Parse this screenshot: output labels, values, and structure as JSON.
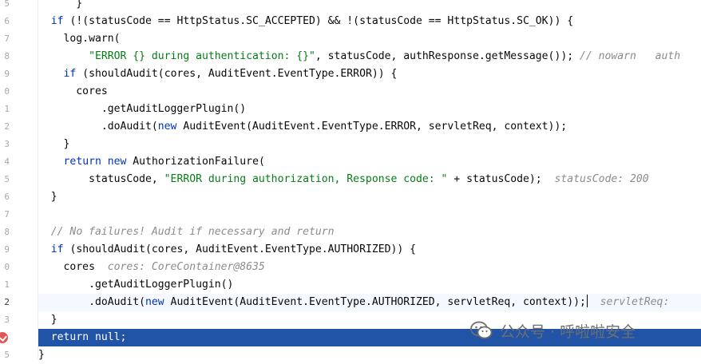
{
  "editor": {
    "gutter": [
      {
        "num": "5"
      },
      {
        "num": "6"
      },
      {
        "num": "7"
      },
      {
        "num": "8"
      },
      {
        "num": "9"
      },
      {
        "num": "0"
      },
      {
        "num": "1"
      },
      {
        "num": "2"
      },
      {
        "num": "3"
      },
      {
        "num": "4"
      },
      {
        "num": "5"
      },
      {
        "num": "6"
      },
      {
        "num": "7"
      },
      {
        "num": "8"
      },
      {
        "num": "9"
      },
      {
        "num": "0"
      },
      {
        "num": "1"
      },
      {
        "num": "2"
      },
      {
        "num": "3"
      },
      {
        "num": ""
      },
      {
        "num": "5"
      }
    ],
    "lines": [
      [
        {
          "t": "      }",
          "c": ""
        }
      ],
      [
        {
          "t": "  ",
          "c": ""
        },
        {
          "t": "if",
          "c": "kw"
        },
        {
          "t": " (!(statusCode == HttpStatus.SC_ACCEPTED) && !(statusCode == HttpStatus.SC_OK)) {",
          "c": ""
        }
      ],
      [
        {
          "t": "    log.warn(",
          "c": ""
        }
      ],
      [
        {
          "t": "        ",
          "c": ""
        },
        {
          "t": "\"ERROR {} during authentication: {}\"",
          "c": "str"
        },
        {
          "t": ", statusCode, authResponse.getMessage()); ",
          "c": ""
        },
        {
          "t": "// nowarn   auth",
          "c": "cm"
        }
      ],
      [
        {
          "t": "    ",
          "c": ""
        },
        {
          "t": "if",
          "c": "kw"
        },
        {
          "t": " (shouldAudit(cores, AuditEvent.EventType.ERROR)) {",
          "c": ""
        }
      ],
      [
        {
          "t": "      cores",
          "c": ""
        }
      ],
      [
        {
          "t": "          .getAuditLoggerPlugin()",
          "c": ""
        }
      ],
      [
        {
          "t": "          .doAudit(",
          "c": ""
        },
        {
          "t": "new",
          "c": "kw"
        },
        {
          "t": " AuditEvent(AuditEvent.EventType.ERROR, servletReq, context));",
          "c": ""
        }
      ],
      [
        {
          "t": "    }",
          "c": ""
        }
      ],
      [
        {
          "t": "    ",
          "c": ""
        },
        {
          "t": "return",
          "c": "kw"
        },
        {
          "t": " ",
          "c": ""
        },
        {
          "t": "new",
          "c": "kw"
        },
        {
          "t": " AuthorizationFailure(",
          "c": ""
        }
      ],
      [
        {
          "t": "        statusCode, ",
          "c": ""
        },
        {
          "t": "\"ERROR during authorization, Response code: \"",
          "c": "str"
        },
        {
          "t": " + statusCode);  ",
          "c": ""
        },
        {
          "t": "statusCode: 200",
          "c": "hint"
        }
      ],
      [
        {
          "t": "  }",
          "c": ""
        }
      ],
      [
        {
          "t": "",
          "c": ""
        }
      ],
      [
        {
          "t": "  ",
          "c": ""
        },
        {
          "t": "// No failures! Audit if necessary and return",
          "c": "cm"
        }
      ],
      [
        {
          "t": "  ",
          "c": ""
        },
        {
          "t": "if",
          "c": "kw"
        },
        {
          "t": " (shouldAudit(cores, AuditEvent.EventType.AUTHORIZED)) {",
          "c": ""
        }
      ],
      [
        {
          "t": "    cores  ",
          "c": ""
        },
        {
          "t": "cores: CoreContainer@8635",
          "c": "hint"
        }
      ],
      [
        {
          "t": "        .getAuditLoggerPlugin()",
          "c": ""
        }
      ],
      [
        {
          "t": "        .doAudit(",
          "c": ""
        },
        {
          "t": "new",
          "c": "kw"
        },
        {
          "t": " AuditEvent(AuditEvent.EventType.AUTHORIZED, servletReq, context));",
          "c": ""
        },
        {
          "t": "",
          "c": "caret"
        },
        {
          "t": "  servletReq:",
          "c": "hint"
        }
      ],
      [
        {
          "t": "  }",
          "c": ""
        }
      ],
      [
        {
          "t": "  ",
          "c": ""
        },
        {
          "t": "return",
          "c": "kw"
        },
        {
          "t": " null;",
          "c": ""
        }
      ],
      [
        {
          "t": "}",
          "c": ""
        }
      ]
    ]
  },
  "watermark": {
    "text": "公众号 · 呼啦啦安全",
    "icon": "wechat-icon"
  }
}
